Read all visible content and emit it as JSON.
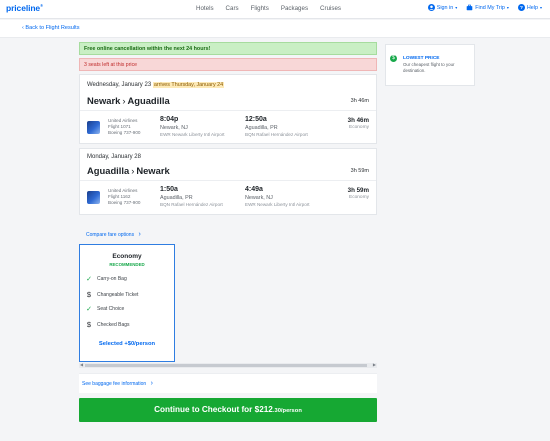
{
  "nav": {
    "logo": "priceline",
    "links": [
      "Hotels",
      "Cars",
      "Flights",
      "Packages",
      "Cruises"
    ],
    "sign_in": "Sign in",
    "find_trip": "Find My Trip",
    "help": "Help"
  },
  "back_link": "‹ Back to Flight Results",
  "banners": {
    "free_cancel": "Free online cancellation within the next 24 hours!",
    "seats_left": "3 seats left at this price"
  },
  "lowest_price": {
    "title": "LOWEST PRICE",
    "desc": "Our cheapest flight to your destination."
  },
  "outbound": {
    "date": "Wednesday, January 23",
    "arrives": "arrives Thursday, January 24",
    "route_from": "Newark",
    "route_to": "Aguadilla",
    "total_duration": "3h 46m",
    "airline": "United Airlines",
    "flight": "Flight 1071",
    "aircraft": "Boeing 737-900",
    "depart_time": "8:04p",
    "depart_city": "Newark, NJ",
    "depart_airport": "EWR Newark Liberty Intl Airport",
    "arrive_time": "12:50a",
    "arrive_city": "Aguadilla, PR",
    "arrive_airport": "BQN Rafael Hernández Airport",
    "duration": "3h 46m",
    "cabin": "Economy"
  },
  "return": {
    "date": "Monday, January 28",
    "route_from": "Aguadilla",
    "route_to": "Newark",
    "total_duration": "3h 59m",
    "airline": "United Airlines",
    "flight": "Flight 1162",
    "aircraft": "Boeing 737-900",
    "depart_time": "1:50a",
    "depart_city": "Aguadilla, PR",
    "depart_airport": "BQN Rafael Hernández Airport",
    "arrive_time": "4:49a",
    "arrive_city": "Newark, NJ",
    "arrive_airport": "EWR Newark Liberty Intl Airport",
    "duration": "3h 59m",
    "cabin": "Economy"
  },
  "compare_link": "Compare fare options",
  "fare": {
    "title": "Economy",
    "recommended": "RECOMMENDED",
    "features": [
      {
        "icon": "check-icon",
        "label": "Carry-on Bag"
      },
      {
        "icon": "dollar-icon",
        "label": "Changeable Ticket"
      },
      {
        "icon": "check-icon",
        "label": "Seat Choice"
      },
      {
        "icon": "dollar-icon",
        "label": "Checked Bags"
      }
    ],
    "selected": "Selected +$0/person"
  },
  "baggage_link": "See baggage fee information",
  "checkout": {
    "label": "Continue to Checkout for $212",
    "cents": ".30/person"
  }
}
